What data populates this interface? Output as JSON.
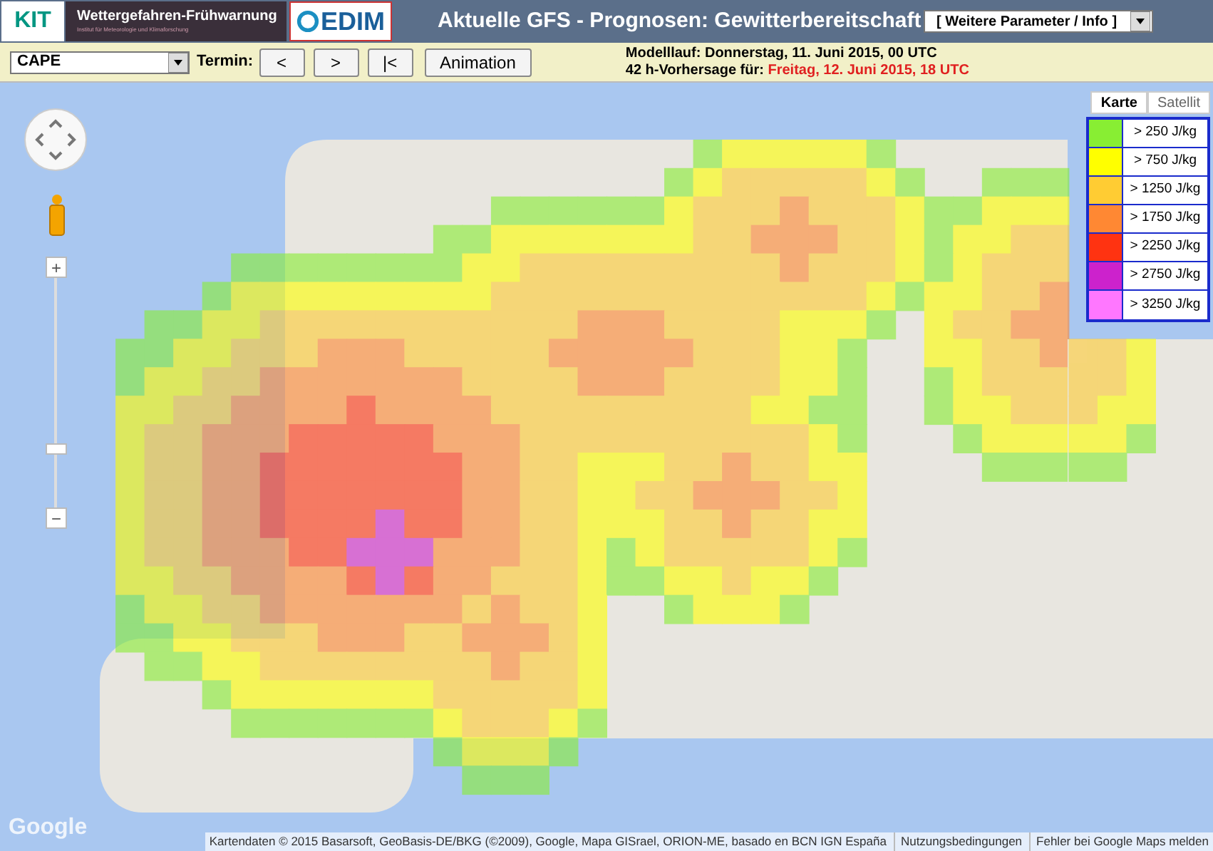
{
  "header": {
    "kit_logo": "KIT",
    "banner": "Wettergefahren-Frühwarnung",
    "banner_subtitle": "Institut für Meteorologie und Klimaforschung",
    "cedim_logo": "EDIM",
    "title": "Aktuelle GFS - Prognosen: Gewitterbereitschaft",
    "menu": {
      "value": "[ Weitere Parameter / Info ]"
    }
  },
  "toolbar": {
    "parameter": {
      "value": "CAPE"
    },
    "termin_label": "Termin:",
    "buttons": [
      "<",
      ">",
      "|<",
      "Animation"
    ],
    "model_run": {
      "label": "Modelllauf:",
      "value": "Donnerstag, 11. Juni 2015, 00 UTC"
    },
    "forecast": {
      "label": "42 h-Vorhersage für:",
      "value": "Freitag, 12. Juni 2015, 18 UTC"
    }
  },
  "map": {
    "map_types": [
      {
        "label": "Karte",
        "selected": true
      },
      {
        "label": "Satellit",
        "selected": false
      }
    ],
    "legend": [
      {
        "label": "> 250 J/kg",
        "color": "#88ee33"
      },
      {
        "label": "> 750 J/kg",
        "color": "#ffff00"
      },
      {
        "label": "> 1250 J/kg",
        "color": "#ffcc33"
      },
      {
        "label": "> 1750 J/kg",
        "color": "#ff8833"
      },
      {
        "label": "> 2250 J/kg",
        "color": "#ff3311"
      },
      {
        "label": "> 2750 J/kg",
        "color": "#cc22cc"
      },
      {
        "label": "> 3250 J/kg",
        "color": "#ff77ff"
      }
    ],
    "zoom_in": "+",
    "zoom_out": "−",
    "google_logo": "Google",
    "attribution": {
      "data": "Kartendaten © 2015 Basarsoft, GeoBasis-DE/BKG (©2009), Google, Mapa GISrael, ORION-ME, basado en BCN IGN España",
      "terms": "Nutzungsbedingungen",
      "report": "Fehler bei Google Maps melden"
    }
  }
}
